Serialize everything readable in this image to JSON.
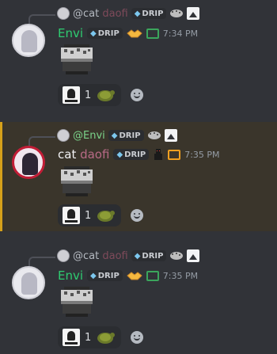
{
  "messages": [
    {
      "reply": {
        "prefix": "@cat",
        "dim": " daofi",
        "tag": "DRIP"
      },
      "author": {
        "name": "Envi",
        "tag": "DRIP",
        "time": "7:34 PM"
      },
      "reaction_count": "1"
    },
    {
      "reply": {
        "prefix": "@Envi",
        "tag": "DRIP"
      },
      "author": {
        "name": "cat",
        "dim": " daofi",
        "tag": "DRIP",
        "time": "7:35 PM"
      },
      "reaction_count": "1"
    },
    {
      "reply": {
        "prefix": "@cat",
        "dim": " daofi",
        "tag": "DRIP"
      },
      "author": {
        "name": "Envi",
        "tag": "DRIP",
        "time": "7:35 PM"
      },
      "reaction_count": "1"
    }
  ],
  "colors": {
    "background": "#313338",
    "highlight_bg": "#3a352b",
    "highlight_bar": "#d6a11a",
    "envi_name": "#2ecc71",
    "cat_name": "#f2f3f5",
    "timestamp": "#949ba4"
  },
  "icons": {
    "tag_gem": "gem-icon",
    "handshake": "handshake-emoji",
    "monitor": "monitor-icon",
    "image": "image-icon",
    "pixel_emoji": "pixel-pot-emoji",
    "reaction_image": "manga-image-emoji",
    "turtle": "turtle-emoji",
    "add_reaction": "add-reaction-icon"
  }
}
